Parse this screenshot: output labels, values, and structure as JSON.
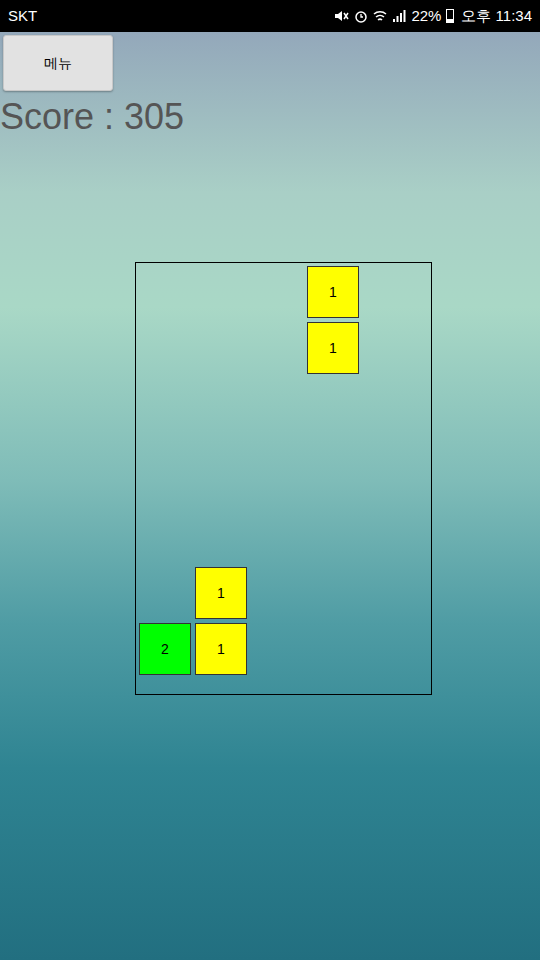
{
  "status_bar": {
    "carrier": "SKT",
    "battery": "22%",
    "battery_level": 0.22,
    "time": "오후 11:34"
  },
  "menu_button": {
    "label": "메뉴"
  },
  "score": {
    "text": "Score : 305"
  },
  "board": {
    "blocks": [
      {
        "text": "1",
        "color": "#ffff00",
        "col": 3,
        "row": 0,
        "falling": true
      },
      {
        "text": "1",
        "color": "#ffff00",
        "col": 3,
        "row": 1,
        "falling": true
      },
      {
        "text": "1",
        "color": "#ffff00",
        "col": 1,
        "row": 5.375,
        "falling": false
      },
      {
        "text": "2",
        "color": "#00ff00",
        "col": 0,
        "row": 6.375,
        "falling": false
      },
      {
        "text": "1",
        "color": "#ffff00",
        "col": 1,
        "row": 6.375,
        "falling": false
      }
    ]
  }
}
